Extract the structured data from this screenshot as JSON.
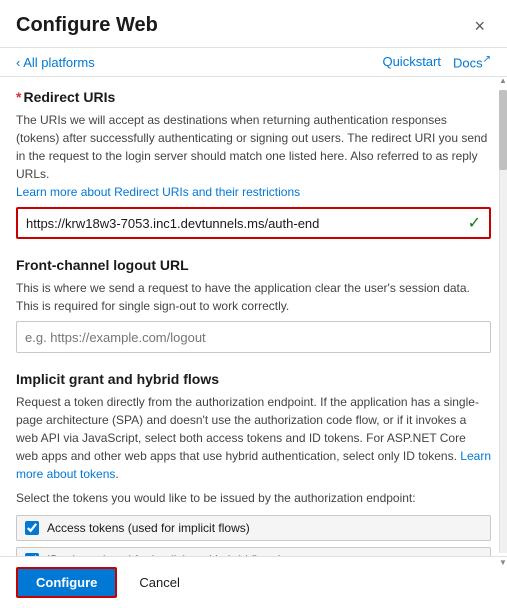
{
  "dialog": {
    "title": "Configure Web",
    "close_label": "×"
  },
  "nav": {
    "back_label": "‹ All platforms",
    "quickstart_label": "Quickstart",
    "docs_label": "Docs",
    "docs_icon": "↗"
  },
  "redirect_uris": {
    "title": "Redirect URIs",
    "required": true,
    "description": "The URIs we will accept as destinations when returning authentication responses (tokens) after successfully authenticating or signing out users. The redirect URI you send in the request to the login server should match one listed here. Also referred to as reply URLs.",
    "link_text": "Learn more about Redirect URIs and their restrictions",
    "input_value": "https://krw18w3-7053.inc1.devtunnels.ms/auth-end",
    "input_check": "✓"
  },
  "logout_url": {
    "title": "Front-channel logout URL",
    "description": "This is where we send a request to have the application clear the user's session data. This is required for single sign-out to work correctly.",
    "placeholder": "e.g. https://example.com/logout"
  },
  "implicit_grant": {
    "title": "Implicit grant and hybrid flows",
    "description": "Request a token directly from the authorization endpoint. If the application has a single-page architecture (SPA) and doesn't use the authorization code flow, or if it invokes a web API via JavaScript, select both access tokens and ID tokens. For ASP.NET Core web apps and other web apps that use hybrid authentication, select only ID tokens.",
    "link_text": "Learn more about tokens",
    "select_label": "Select the tokens you would like to be issued by the authorization endpoint:",
    "checkboxes": [
      {
        "id": "access-tokens",
        "label": "Access tokens (used for implicit flows)",
        "checked": true
      },
      {
        "id": "id-tokens",
        "label": "ID tokens (used for implicit and hybrid flows)",
        "checked": true
      }
    ]
  },
  "footer": {
    "configure_label": "Configure",
    "cancel_label": "Cancel"
  }
}
